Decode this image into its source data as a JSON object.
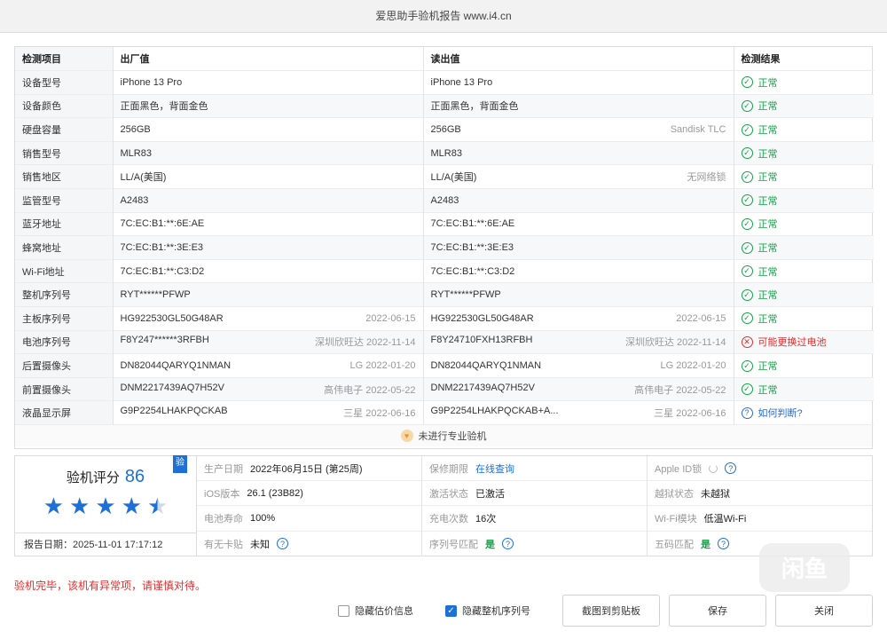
{
  "window": {
    "title": "爱思助手验机报告 www.i4.cn"
  },
  "table": {
    "headers": [
      "检测项目",
      "出厂值",
      "读出值",
      "检测结果"
    ],
    "rows": [
      {
        "name": "设备型号",
        "factory": "iPhone 13 Pro",
        "factory_note": "",
        "read": "iPhone 13 Pro",
        "read_note": "",
        "status": "ok",
        "result": "正常"
      },
      {
        "name": "设备颜色",
        "factory": "正面黑色，背面金色",
        "factory_note": "",
        "read": "正面黑色，背面金色",
        "read_note": "",
        "status": "ok",
        "result": "正常"
      },
      {
        "name": "硬盘容量",
        "factory": "256GB",
        "factory_note": "",
        "read": "256GB",
        "read_note": "Sandisk TLC",
        "status": "ok",
        "result": "正常"
      },
      {
        "name": "销售型号",
        "factory": "MLR83",
        "factory_note": "",
        "read": "MLR83",
        "read_note": "",
        "status": "ok",
        "result": "正常"
      },
      {
        "name": "销售地区",
        "factory": "LL/A(美国)",
        "factory_note": "",
        "read": "LL/A(美国)",
        "read_note": "无网络锁",
        "status": "ok",
        "result": "正常"
      },
      {
        "name": "监管型号",
        "factory": "A2483",
        "factory_note": "",
        "read": "A2483",
        "read_note": "",
        "status": "ok",
        "result": "正常"
      },
      {
        "name": "蓝牙地址",
        "factory": "7C:EC:B1:**:6E:AE",
        "factory_note": "",
        "read": "7C:EC:B1:**:6E:AE",
        "read_note": "",
        "status": "ok",
        "result": "正常"
      },
      {
        "name": "蜂窝地址",
        "factory": "7C:EC:B1:**:3E:E3",
        "factory_note": "",
        "read": "7C:EC:B1:**:3E:E3",
        "read_note": "",
        "status": "ok",
        "result": "正常"
      },
      {
        "name": "Wi-Fi地址",
        "factory": "7C:EC:B1:**:C3:D2",
        "factory_note": "",
        "read": "7C:EC:B1:**:C3:D2",
        "read_note": "",
        "status": "ok",
        "result": "正常"
      },
      {
        "name": "整机序列号",
        "factory": "RYT******PFWP",
        "factory_note": "",
        "read": "RYT******PFWP",
        "read_note": "",
        "status": "ok",
        "result": "正常"
      },
      {
        "name": "主板序列号",
        "factory": "HG922530GL50G48AR",
        "factory_note": "2022-06-15",
        "read": "HG922530GL50G48AR",
        "read_note": "2022-06-15",
        "status": "ok",
        "result": "正常"
      },
      {
        "name": "电池序列号",
        "factory": "F8Y247******3RFBH",
        "factory_note": "深圳欣旺达 2022-11-14",
        "read": "F8Y24710FXH13RFBH",
        "read_note": "深圳欣旺达 2022-11-14",
        "status": "bad",
        "result": "可能更换过电池"
      },
      {
        "name": "后置摄像头",
        "factory": "DN82044QARYQ1NMAN",
        "factory_note": "LG 2022-01-20",
        "read": "DN82044QARYQ1NMAN",
        "read_note": "LG 2022-01-20",
        "status": "ok",
        "result": "正常"
      },
      {
        "name": "前置摄像头",
        "factory": "DNM2217439AQ7H52V",
        "factory_note": "高伟电子 2022-05-22",
        "read": "DNM2217439AQ7H52V",
        "read_note": "高伟电子 2022-05-22",
        "status": "ok",
        "result": "正常"
      },
      {
        "name": "液晶显示屏",
        "factory": "G9P2254LHAKPQCKAB",
        "factory_note": "三星 2022-06-16",
        "read": "G9P2254LHAKPQCKAB+A...",
        "read_note": "三星 2022-06-16",
        "status": "ask",
        "result": "如何判断?"
      }
    ],
    "footer": "未进行专业验机"
  },
  "summary": {
    "score_label": "验机评分",
    "score": "86",
    "rating_stars": 4.5,
    "badge": "验",
    "report_date": "报告日期：2025-11-01 17:17:12",
    "cells": [
      {
        "key": "生产日期",
        "value": "2022年06月15日 (第25周)",
        "style": ""
      },
      {
        "key": "保修期限",
        "value": "在线查询",
        "style": "link"
      },
      {
        "key": "Apple ID锁",
        "value": "",
        "style": "spin-help"
      },
      {
        "key": "iOS版本",
        "value": "26.1 (23B82)",
        "style": ""
      },
      {
        "key": "激活状态",
        "value": "已激活",
        "style": ""
      },
      {
        "key": "越狱状态",
        "value": "未越狱",
        "style": ""
      },
      {
        "key": "电池寿命",
        "value": "100%",
        "style": ""
      },
      {
        "key": "充电次数",
        "value": "16次",
        "style": ""
      },
      {
        "key": "Wi-Fi模块",
        "value": "低温Wi-Fi",
        "style": ""
      },
      {
        "key": "有无卡贴",
        "value": "未知",
        "style": "help"
      },
      {
        "key": "序列号匹配",
        "value": "是",
        "style": "green-help"
      },
      {
        "key": "五码匹配",
        "value": "是",
        "style": "green-help"
      }
    ]
  },
  "warning": "验机完毕，该机有异常项，请谨慎对待。",
  "actions": {
    "hide_price_label": "隐藏估价信息",
    "hide_price_checked": false,
    "hide_serial_label": "隐藏整机序列号",
    "hide_serial_checked": true,
    "copy_label": "截图到剪贴板",
    "save_label": "保存",
    "close_label": "关闭"
  },
  "watermark": "闲鱼",
  "colors": {
    "accent": "#1e6fd6",
    "ok": "#17a24a",
    "error": "#e02e2e"
  }
}
